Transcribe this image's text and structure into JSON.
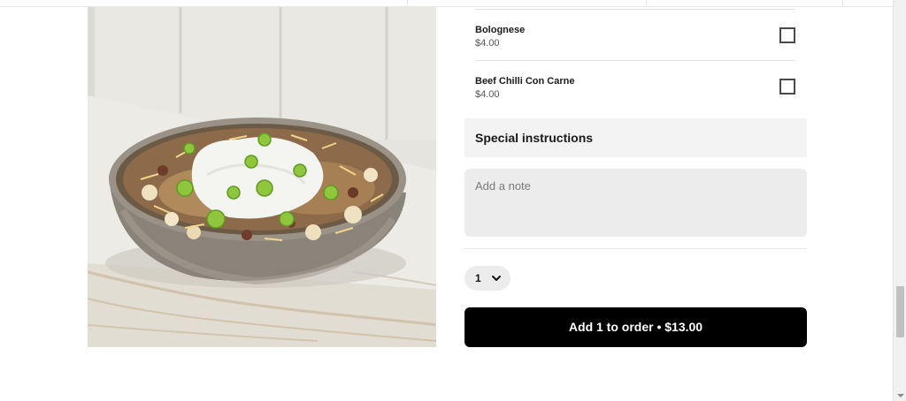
{
  "options": [
    {
      "name": "Bolognese",
      "price": "$4.00",
      "checked": false
    },
    {
      "name": "Beef Chilli Con Carne",
      "price": "$4.00",
      "checked": false
    }
  ],
  "special": {
    "title": "Special instructions",
    "note_placeholder": "Add a note",
    "note_value": ""
  },
  "quantity": {
    "value": "1"
  },
  "add_button": {
    "label": "Add 1 to order • $13.00"
  },
  "image": {
    "alt": "Loaded potato bowl with mince, cheese, sour cream and spring onion"
  },
  "colors": {
    "button_bg": "#000000",
    "panel_bg": "#f3f3f3",
    "input_bg": "#ececec"
  }
}
